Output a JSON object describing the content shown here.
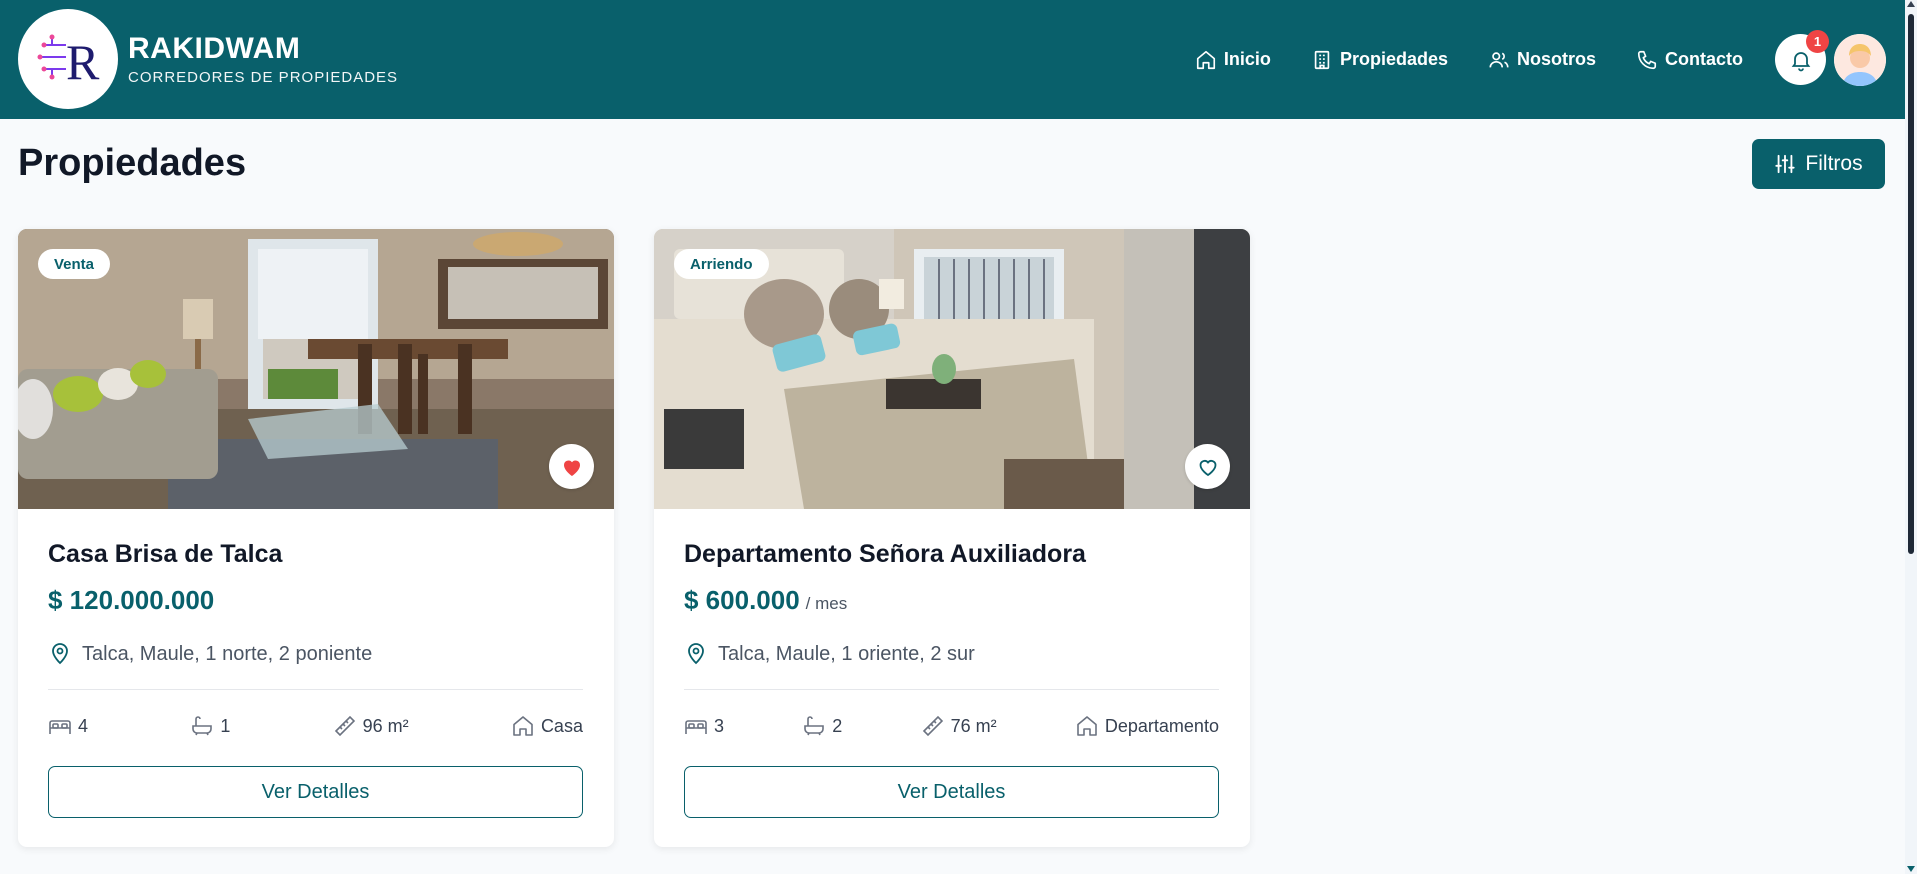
{
  "brand": {
    "name": "RAKIDWAM",
    "subtitle": "CORREDORES DE PROPIEDADES",
    "logo_letter": "R"
  },
  "nav": {
    "items": [
      {
        "label": "Inicio",
        "icon": "home-icon"
      },
      {
        "label": "Propiedades",
        "icon": "building-icon"
      },
      {
        "label": "Nosotros",
        "icon": "users-icon"
      },
      {
        "label": "Contacto",
        "icon": "phone-icon"
      }
    ]
  },
  "notifications": {
    "count": "1",
    "icon": "bell-icon"
  },
  "page": {
    "title": "Propiedades",
    "filter_label": "Filtros"
  },
  "properties": [
    {
      "tag": "Venta",
      "title": "Casa Brisa de Talca",
      "price": "$ 120.000.000",
      "price_unit": "",
      "location": "Talca, Maule, 1 norte, 2 poniente",
      "bedrooms": "4",
      "bathrooms": "1",
      "area": "96 m²",
      "type": "Casa",
      "favorited": true,
      "details_label": "Ver Detalles"
    },
    {
      "tag": "Arriendo",
      "title": "Departamento Señora Auxiliadora",
      "price": "$ 600.000",
      "price_unit": "/ mes",
      "location": "Talca, Maule, 1 oriente, 2 sur",
      "bedrooms": "3",
      "bathrooms": "2",
      "area": "76 m²",
      "type": "Departamento",
      "favorited": false,
      "details_label": "Ver Detalles"
    }
  ],
  "colors": {
    "primary": "#09606b",
    "favorite": "#ef4444",
    "badge": "#ef4444"
  }
}
